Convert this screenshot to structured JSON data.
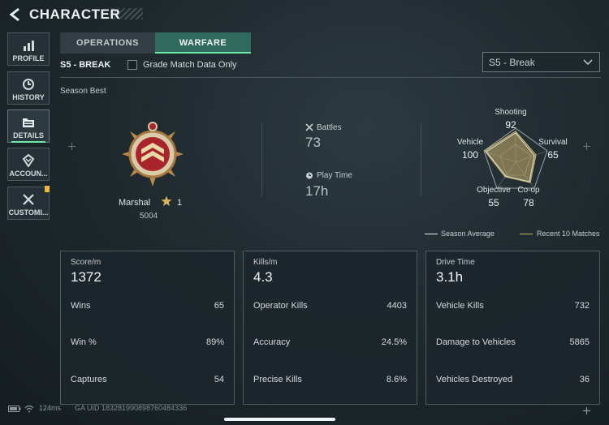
{
  "header": {
    "title": "CHARACTER"
  },
  "sidebar": {
    "items": [
      {
        "label": "PROFILE",
        "icon": "bar-chart-icon"
      },
      {
        "label": "HISTORY",
        "icon": "clock-icon"
      },
      {
        "label": "DETAILS",
        "icon": "folder-icon",
        "active": true
      },
      {
        "label": "ACCOUN...",
        "icon": "badge-icon"
      },
      {
        "label": "CUSTOMI...",
        "icon": "wrench-icon"
      }
    ]
  },
  "tabs": [
    {
      "label": "OPERATIONS"
    },
    {
      "label": "WARFARE",
      "active": true
    }
  ],
  "season": {
    "name": "S5 - BREAK",
    "grade_only_label": "Grade Match Data Only",
    "grade_only_checked": false,
    "selector_value": "S5 - Break",
    "section_label": "Season Best"
  },
  "rank": {
    "name": "Marshal",
    "level": "1",
    "points": "5004"
  },
  "battles": {
    "label": "Battles",
    "value": "73"
  },
  "play_time": {
    "label": "Play Time",
    "value": "17h"
  },
  "radar": {
    "axes": [
      {
        "label": "Shooting",
        "value": "92"
      },
      {
        "label": "Survival",
        "value": "65"
      },
      {
        "label": "Co-op",
        "value": "78"
      },
      {
        "label": "Objective",
        "value": "55"
      },
      {
        "label": "Vehicle",
        "value": "100"
      }
    ],
    "legend": {
      "season_average": "Season Average",
      "recent": "Recent 10 Matches"
    }
  },
  "cards": [
    {
      "headline_label": "Score/m",
      "headline_value": "1372",
      "rows": [
        {
          "name": "Wins",
          "value": "65"
        },
        {
          "name": "Win %",
          "value": "89%"
        },
        {
          "name": "Captures",
          "value": "54"
        }
      ]
    },
    {
      "headline_label": "Kills/m",
      "headline_value": "4.3",
      "rows": [
        {
          "name": "Operator Kills",
          "value": "4403"
        },
        {
          "name": "Accuracy",
          "value": "24.5%"
        },
        {
          "name": "Precise Kills",
          "value": "8.6%"
        }
      ]
    },
    {
      "headline_label": "Drive Time",
      "headline_value": "3.1h",
      "rows": [
        {
          "name": "Vehicle Kills",
          "value": "732"
        },
        {
          "name": "Damage to Vehicles",
          "value": "5865"
        },
        {
          "name": "Vehicles Destroyed",
          "value": "36"
        }
      ]
    }
  ],
  "status": {
    "ping": "124ms",
    "uid": "GA UID 1832819908987604843​36"
  },
  "colors": {
    "accent": "#6ee8a8",
    "tab_active": "#2f6a5c",
    "recent_line": "#c8b06a",
    "badge": "#e9b93a"
  }
}
